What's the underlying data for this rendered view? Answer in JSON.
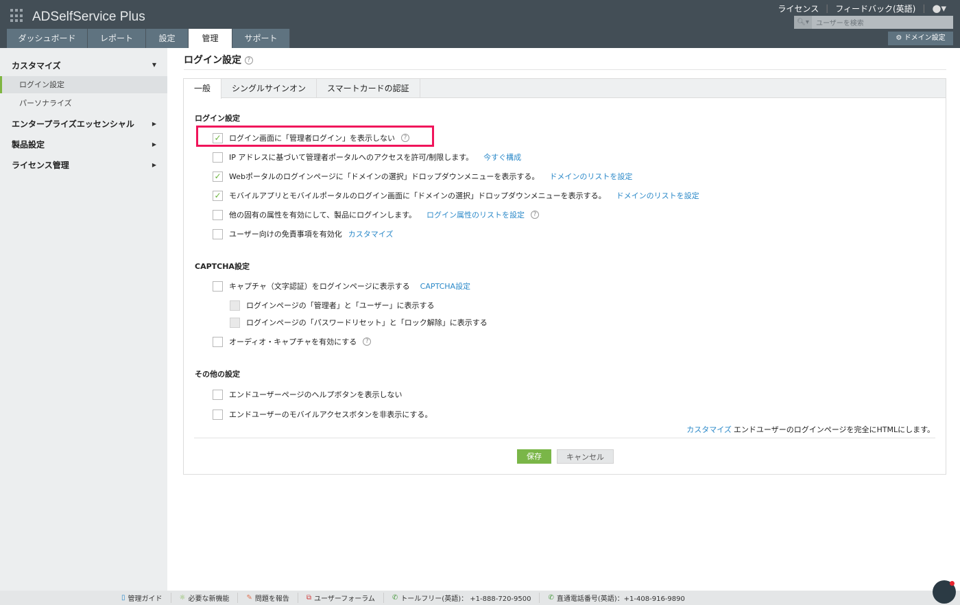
{
  "header": {
    "logo": "ADSelfService Plus",
    "tabs": [
      "ダッシュボード",
      "レポート",
      "設定",
      "管理",
      "サポート"
    ],
    "active_tab": "管理",
    "links": [
      "ライセンス",
      "フィードバック(英語)"
    ],
    "search_placeholder": "ユーザーを検索",
    "domain_button": "ドメイン設定"
  },
  "sidebar": {
    "groups": [
      {
        "label": "カスタマイズ",
        "items": [
          "ログイン設定",
          "パーソナライズ"
        ]
      },
      {
        "label": "エンタープライズエッセンシャル"
      },
      {
        "label": "製品設定"
      },
      {
        "label": "ライセンス管理"
      }
    ],
    "active_item": "ログイン設定"
  },
  "page": {
    "title": "ログイン設定",
    "tabs": [
      "一般",
      "シングルサインオン",
      "スマートカードの認証"
    ],
    "sections": {
      "login": "ログイン設定",
      "captcha": "CAPTCHA設定",
      "other": "その他の設定"
    },
    "options": [
      {
        "label": "ログイン画面に「管理者ログイン」を表示しない",
        "checked": true
      },
      {
        "label": "IP アドレスに基づいて管理者ポータルへのアクセスを許可/制限します。",
        "link": "今すぐ構成",
        "checked": false
      },
      {
        "label": "Webポータルのログインページに「ドメインの選択」ドロップダウンメニューを表示する。",
        "link": "ドメインのリストを設定",
        "checked": true
      },
      {
        "label": "モバイルアプリとモバイルポータルのログイン画面に「ドメインの選択」ドロップダウンメニューを表示する。",
        "link": "ドメインのリストを設定",
        "checked": true
      },
      {
        "label": "他の固有の属性を有効にして、製品にログインします。",
        "link": "ログイン属性のリストを設定",
        "checked": false
      },
      {
        "label": "ユーザー向けの免責事項を有効化",
        "link": "カスタマイズ",
        "checked": false
      },
      {
        "label": "キャプチャ（文字認証）をログインページに表示する",
        "link": "CAPTCHA設定",
        "checked": false
      },
      {
        "label": "ログインページの「管理者」と「ユーザー」に表示する",
        "checked": false
      },
      {
        "label": "ログインページの「パスワードリセット」と「ロック解除」に表示する",
        "checked": false
      },
      {
        "label": "オーディオ・キャプチャを有効にする",
        "checked": false
      },
      {
        "label": "エンドユーザーページのヘルプボタンを表示しない",
        "checked": false
      },
      {
        "label": "エンドユーザーのモバイルアクセスボタンを非表示にする。",
        "checked": false
      }
    ],
    "customize_link": "カスタマイズ",
    "customize_text": "エンドユーザーのログインページを完全にHTMLにします。",
    "save": "保存",
    "cancel": "キャンセル"
  },
  "footer": [
    "管理ガイド",
    "必要な新機能",
    "問題を報告",
    "ユーザーフォーラム",
    "トールフリー(英語)： +1-888-720-9500",
    "直通電話番号(英語)：+1-408-916-9890"
  ]
}
